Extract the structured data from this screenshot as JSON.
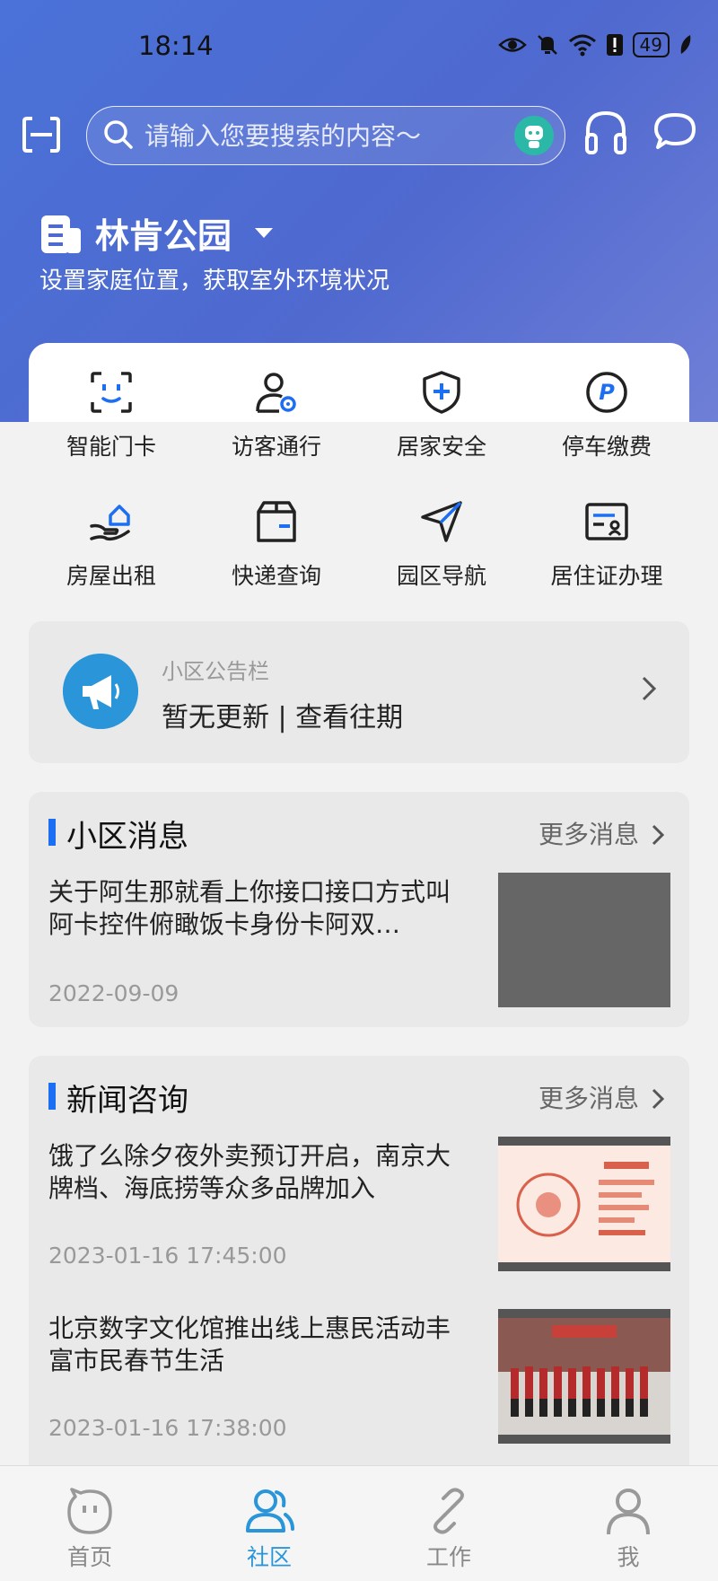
{
  "status_bar": {
    "time": "18:14",
    "battery": "49"
  },
  "search": {
    "placeholder": "请输入您要搜索的内容～"
  },
  "location": {
    "name": "林肯公园",
    "subtitle": "设置家庭位置，获取室外环境状况"
  },
  "services": [
    {
      "label": "智能门卡",
      "icon": "face-scan-icon"
    },
    {
      "label": "访客通行",
      "icon": "visitor-icon"
    },
    {
      "label": "居家安全",
      "icon": "shield-plus-icon"
    },
    {
      "label": "停车缴费",
      "icon": "parking-icon"
    },
    {
      "label": "房屋出租",
      "icon": "house-hand-icon"
    },
    {
      "label": "快递查询",
      "icon": "package-icon"
    },
    {
      "label": "园区导航",
      "icon": "navigation-icon"
    },
    {
      "label": "居住证办理",
      "icon": "id-card-icon"
    }
  ],
  "notice": {
    "title": "小区公告栏",
    "text": "暂无更新 | 查看往期"
  },
  "community_news": {
    "title": "小区消息",
    "more": "更多消息",
    "items": [
      {
        "title": "关于阿生那就看上你接口接口方式叫阿卡控件俯瞰饭卡身份卡阿双…",
        "date": "2022-09-09"
      }
    ]
  },
  "news": {
    "title": "新闻咨询",
    "more": "更多消息",
    "items": [
      {
        "title": "饿了么除夕夜外卖预订开启，南京大牌档、海底捞等众多品牌加入",
        "date": "2023-01-16 17:45:00"
      },
      {
        "title": "北京数字文化馆推出线上惠民活动丰富市民春节生活",
        "date": "2023-01-16 17:38:00"
      }
    ]
  },
  "tabs": [
    {
      "label": "首页",
      "icon": "home-face-icon"
    },
    {
      "label": "社区",
      "icon": "community-icon",
      "active": true
    },
    {
      "label": "工作",
      "icon": "link-icon"
    },
    {
      "label": "我",
      "icon": "person-icon"
    }
  ],
  "colors": {
    "accent": "#2a96d9",
    "header": "#4f69cf",
    "bar": "#1c6ef2"
  }
}
